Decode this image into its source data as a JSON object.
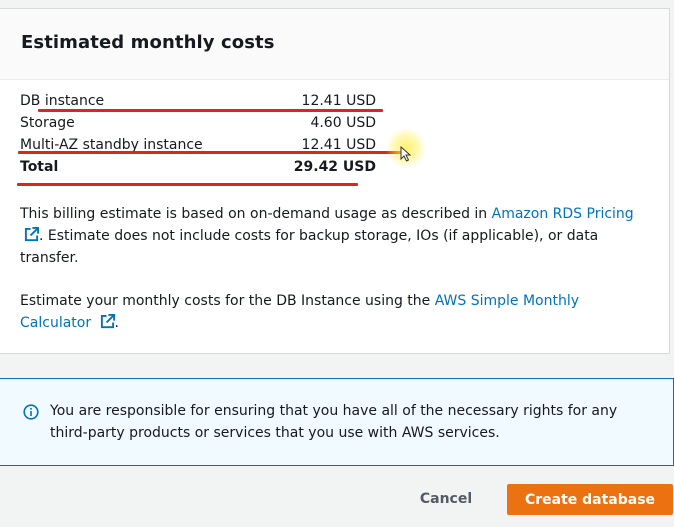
{
  "card": {
    "title": "Estimated monthly costs",
    "costs": [
      {
        "label": "DB instance",
        "value": "12.41 USD"
      },
      {
        "label": "Storage",
        "value": "4.60 USD"
      },
      {
        "label": "Multi-AZ standby instance",
        "value": "12.41 USD"
      },
      {
        "label": "Total",
        "value": "29.42 USD"
      }
    ],
    "billing_note_before": "This billing estimate is based on on-demand usage as described in ",
    "billing_link": "Amazon RDS Pricing",
    "billing_note_after": ". Estimate does not include costs for backup storage, IOs (if applicable), or data transfer.",
    "calc_note_before": "Estimate your monthly costs for the DB Instance using the ",
    "calc_link": "AWS Simple Monthly Calculator",
    "calc_note_after": "."
  },
  "info": {
    "text": "You are responsible for ensuring that you have all of the necessary rights for any third-party products or services that you use with AWS services."
  },
  "footer": {
    "cancel_label": "Cancel",
    "create_label": "Create database"
  },
  "colors": {
    "link": "#0073bb",
    "primary_button": "#ec7211",
    "annotation_red": "#d9271f",
    "info_border": "#0073bb"
  },
  "icons": [
    "external-link-icon",
    "info-icon",
    "mouse-cursor-icon"
  ]
}
